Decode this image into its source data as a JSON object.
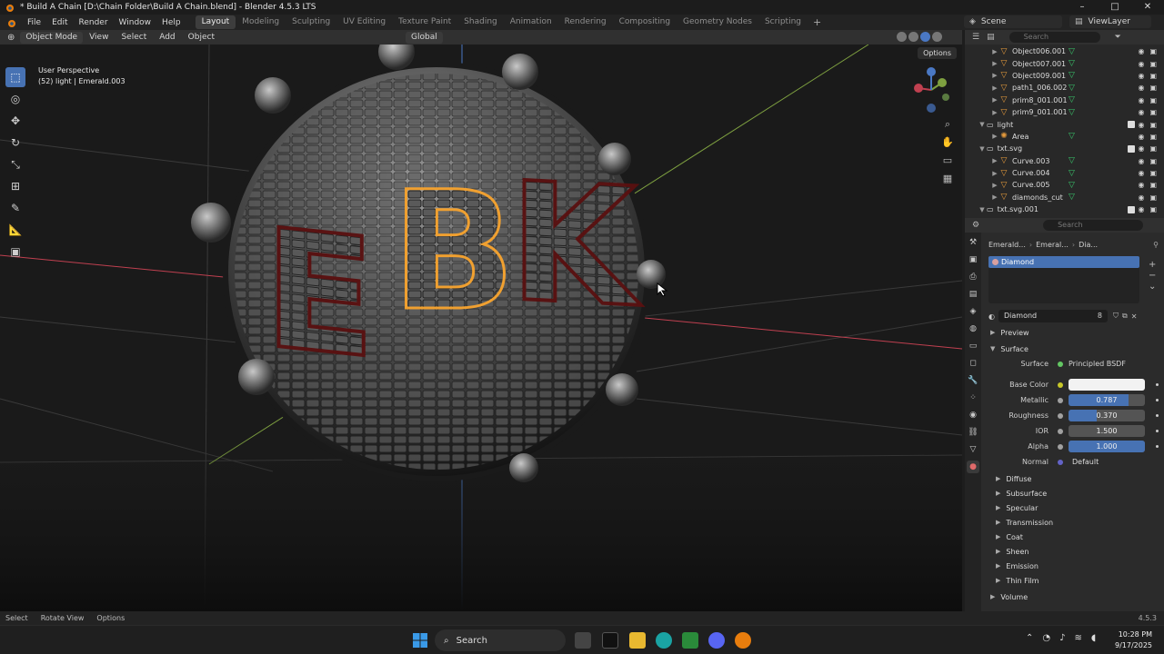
{
  "window": {
    "title": "* Build A Chain [D:\\Chain Folder\\Build A Chain.blend] - Blender 4.5.3 LTS",
    "controls": [
      "–",
      "□",
      "✕"
    ]
  },
  "menubar": {
    "items": [
      "File",
      "Edit",
      "Render",
      "Window",
      "Help"
    ],
    "workspaces": [
      "Layout",
      "Modeling",
      "Sculpting",
      "UV Editing",
      "Texture Paint",
      "Shading",
      "Animation",
      "Rendering",
      "Compositing",
      "Geometry Nodes",
      "Scripting"
    ],
    "active_workspace": "Layout",
    "scene": "Scene",
    "view_layer": "ViewLayer"
  },
  "viewport_header": {
    "mode": "Object Mode",
    "menus": [
      "View",
      "Select",
      "Add",
      "Object"
    ],
    "orientation": "Global"
  },
  "viewport": {
    "perspective": "User Perspective",
    "info": "(52) light | Emerald.003",
    "options_label": "Options",
    "logo_letters": "EBK",
    "gizmo_axes": [
      "X",
      "Y",
      "Z"
    ]
  },
  "outliner": {
    "search_placeholder": "Search",
    "rows": [
      {
        "name": "Object006.001",
        "type": "object",
        "indent": 2
      },
      {
        "name": "Object007.001",
        "type": "object",
        "indent": 2
      },
      {
        "name": "Object009.001",
        "type": "object",
        "indent": 2
      },
      {
        "name": "path1_006.002",
        "type": "object",
        "indent": 2
      },
      {
        "name": "prim8_001.001",
        "type": "object",
        "indent": 2
      },
      {
        "name": "prim9_001.001",
        "type": "object",
        "indent": 2
      },
      {
        "name": "light",
        "type": "collection",
        "indent": 1
      },
      {
        "name": "Area",
        "type": "light",
        "indent": 2
      },
      {
        "name": "txt.svg",
        "type": "collection",
        "indent": 1
      },
      {
        "name": "Curve.003",
        "type": "object",
        "indent": 2
      },
      {
        "name": "Curve.004",
        "type": "object",
        "indent": 2
      },
      {
        "name": "Curve.005",
        "type": "object",
        "indent": 2
      },
      {
        "name": "diamonds_cut",
        "type": "object",
        "indent": 2
      },
      {
        "name": "txt.svg.001",
        "type": "collection",
        "indent": 1
      }
    ]
  },
  "properties": {
    "search_placeholder": "Search",
    "breadcrumb": [
      "Emerald...",
      "Emeral...",
      "Dia..."
    ],
    "slot": "Diamond",
    "material_name": "Diamond",
    "material_users": "8",
    "preview_label": "Preview",
    "surface_label": "Surface",
    "surface_shader_label": "Surface",
    "surface_shader": "Principled BSDF",
    "fields": [
      {
        "label": "Base Color",
        "value": "",
        "kind": "color",
        "color": "#f2f2f2",
        "fraction": null
      },
      {
        "label": "Metallic",
        "value": "0.787",
        "kind": "slider",
        "fraction": 0.787
      },
      {
        "label": "Roughness",
        "value": "0.370",
        "kind": "slider",
        "fraction": 0.37
      },
      {
        "label": "IOR",
        "value": "1.500",
        "kind": "number",
        "fraction": 0
      },
      {
        "label": "Alpha",
        "value": "1.000",
        "kind": "slider",
        "fraction": 1.0
      },
      {
        "label": "Normal",
        "value": "Default",
        "kind": "plain",
        "fraction": null
      }
    ],
    "subpanels": [
      "Diffuse",
      "Subsurface",
      "Specular",
      "Transmission",
      "Coat",
      "Sheen",
      "Emission",
      "Thin Film"
    ],
    "volume_label": "Volume"
  },
  "statusbar": {
    "items": [
      "Select",
      "Rotate View",
      "Options"
    ],
    "version": "4.5.3"
  },
  "taskbar": {
    "search": "Search",
    "time": "10:28 PM",
    "date": "9/17/2025"
  },
  "colors": {
    "accent": "#4772b3",
    "selection_orange": "#f0a030",
    "x_axis": "#c04050",
    "y_axis": "#7ea040",
    "z_axis": "#4a78c4"
  }
}
